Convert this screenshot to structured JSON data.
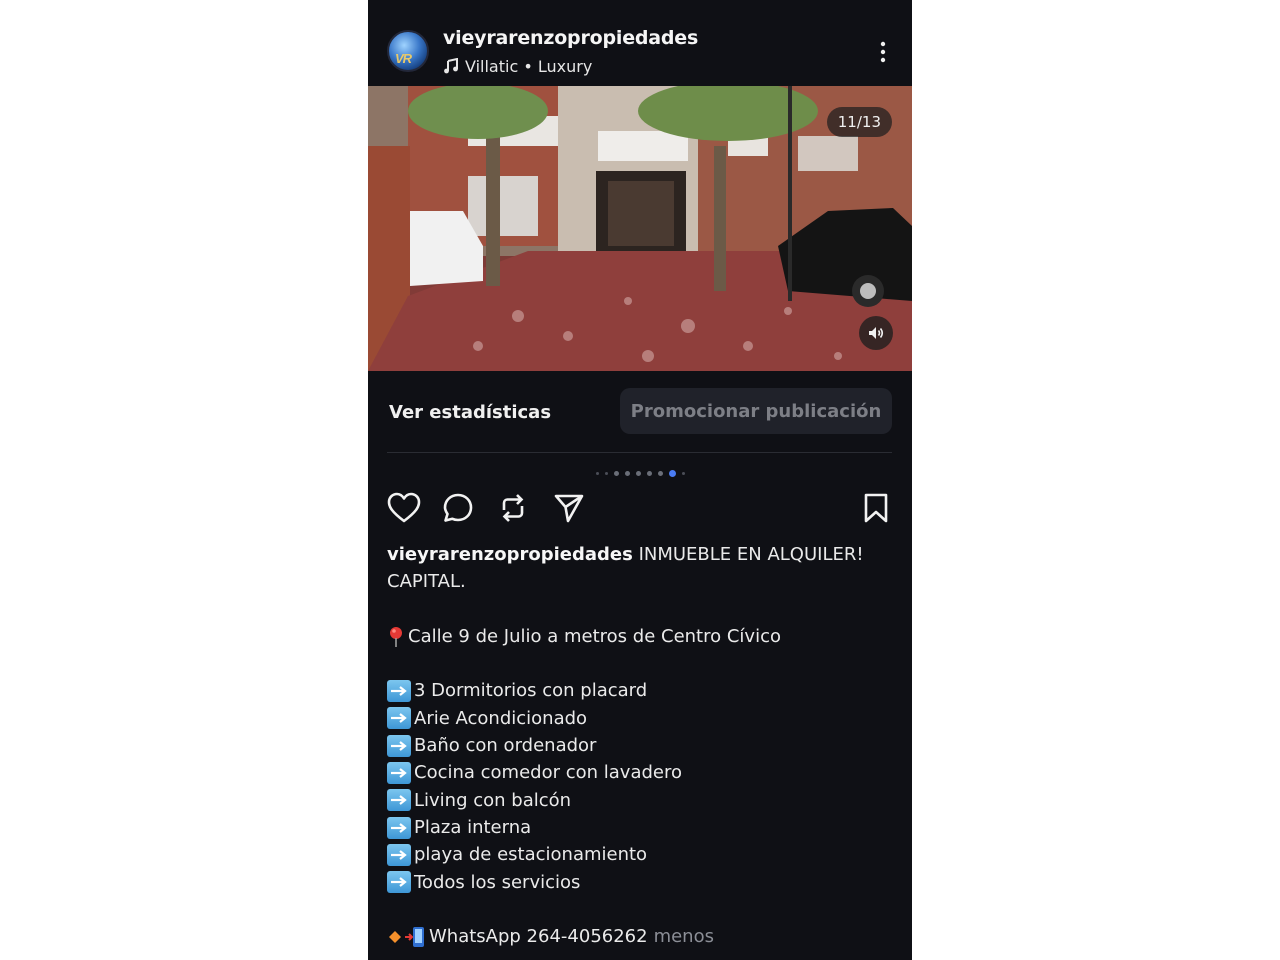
{
  "post": {
    "username": "vieyrarenzopropiedades",
    "music": "Villatic • Luxury",
    "avatar_text": "VR",
    "media_counter": "11/13"
  },
  "actions": {
    "stats_label": "Ver estadísticas",
    "promote_label": "Promocionar publicación"
  },
  "carousel": {
    "total_dots": 9,
    "active_index": 7
  },
  "caption": {
    "username": "vieyrarenzopropiedades",
    "headline": "INMUEBLE EN ALQUILER!",
    "headline_2": "CAPITAL.",
    "location": "Calle 9 de Julio a metros de Centro Cívico",
    "features": [
      "3 Dormitorios con placard",
      "Arie Acondicionado",
      "Baño con ordenador",
      "Cocina comedor con lavadero",
      "Living con balcón",
      "Plaza interna",
      "playa de estacionamiento",
      "Todos los servicios"
    ],
    "contact": "WhatsApp 264-4056262",
    "more_label": "menos"
  },
  "icons": {
    "like": "heart-icon",
    "comment": "comment-icon",
    "repost": "repost-icon",
    "share": "send-icon",
    "save": "bookmark-icon",
    "more": "more-vertical-icon",
    "music": "music-note-icon",
    "mute": "speaker-icon",
    "location": "pin-icon",
    "feature_bullet": "right-arrow-icon"
  }
}
